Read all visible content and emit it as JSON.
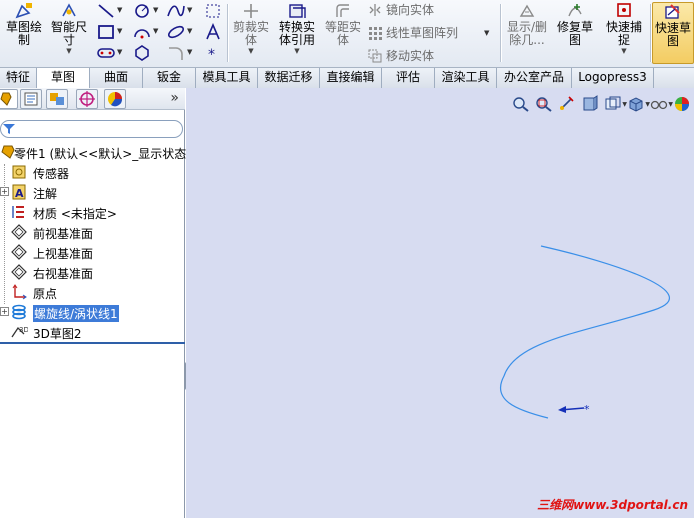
{
  "ribbon": {
    "sketch": "草图绘\n制",
    "smart_dim": "智能尺\n寸",
    "trim": "剪裁实\n体",
    "convert": "转换实\n体引用",
    "offset": "等距实\n体",
    "mirror": "镜向实体",
    "linear_pattern": "线性草图阵列",
    "move": "移动实体",
    "show_delete": "显示/删\n除几...",
    "repair": "修复草\n图",
    "quick_snap": "快速捕\n捉",
    "rapid_sketch": "快速草\n图",
    "trim_sub": "①"
  },
  "tabs": [
    {
      "label": "特征"
    },
    {
      "label": "草图"
    },
    {
      "label": "曲面"
    },
    {
      "label": "钣金"
    },
    {
      "label": "模具工具"
    },
    {
      "label": "数据迁移"
    },
    {
      "label": "直接编辑"
    },
    {
      "label": "评估"
    },
    {
      "label": "渲染工具"
    },
    {
      "label": "办公室产品"
    },
    {
      "label": "Logopress3"
    }
  ],
  "panel": {
    "expand": "»",
    "tree": [
      {
        "label": "零件1 (默认<<默认>_显示状态"
      },
      {
        "label": "传感器"
      },
      {
        "label": "注解"
      },
      {
        "label": "材质 <未指定>"
      },
      {
        "label": "前视基准面"
      },
      {
        "label": "上视基准面"
      },
      {
        "label": "右视基准面"
      },
      {
        "label": "原点"
      },
      {
        "label": "螺旋线/涡状线1"
      },
      {
        "label": "3D草图2"
      }
    ]
  },
  "watermark": "三维网www.3dportal.cn",
  "colors": {
    "graphics_bg": "#d7dcf1",
    "curve": "#3a8fe8",
    "selection": "#3d7bd8",
    "watermark": "#e01414"
  }
}
